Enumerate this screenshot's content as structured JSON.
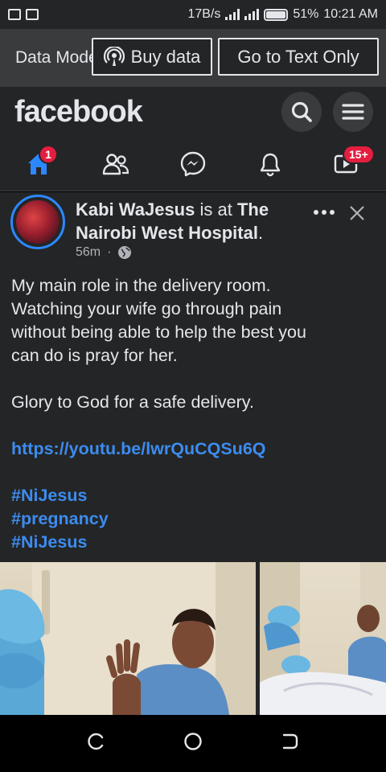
{
  "status_bar": {
    "speed": "17B/s",
    "battery": "51%",
    "time": "10:21 AM"
  },
  "data_banner": {
    "label": "Data Mode",
    "buy_data_label": "Buy data",
    "text_only_label": "Go to Text Only"
  },
  "header": {
    "logo": "facebook",
    "search_icon": "search-icon",
    "menu_icon": "hamburger-menu-icon"
  },
  "nav": {
    "tabs": [
      {
        "name": "home",
        "icon": "home-icon",
        "badge": "1"
      },
      {
        "name": "friends",
        "icon": "friends-icon",
        "badge": ""
      },
      {
        "name": "messenger",
        "icon": "messenger-icon",
        "badge": ""
      },
      {
        "name": "notifications",
        "icon": "bell-icon",
        "badge": ""
      },
      {
        "name": "watch",
        "icon": "video-icon",
        "badge": "15+"
      }
    ],
    "active_color": "#2d88ff"
  },
  "post": {
    "author": "Kabi WaJesus",
    "is_at": " is at ",
    "location": "The Nairobi West Hospital",
    "period": ".",
    "time": "56m",
    "separator": "·",
    "privacy_icon": "globe-icon",
    "lines": [
      "My main role in the delivery room.",
      "Watching your wife go through pain",
      "without being able to help the best you",
      "can do is pray for her."
    ],
    "line2": "Glory to God for a safe delivery.",
    "link": "https://youtu.be/lwrQuCQSu6Q",
    "hashtags": [
      "#NiJesus",
      "#pregnancy",
      "#NiJesus"
    ]
  },
  "colors": {
    "background": "#242526",
    "text": "#e4e6eb",
    "link": "#3c8cf0",
    "badge": "#e41e3f"
  }
}
